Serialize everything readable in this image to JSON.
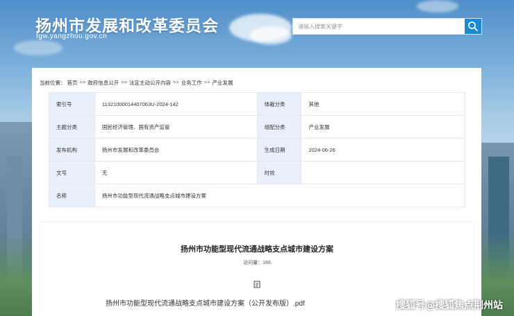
{
  "header": {
    "site_title": "扬州市发展和改革委员会",
    "site_domain": "fgw.yangzhou.gov.cn",
    "search_placeholder": "请输入搜索关键字",
    "search_icon": "search-icon"
  },
  "breadcrumb": {
    "prefix": "当前位置：",
    "separator": ">>",
    "items": [
      "首页",
      "政府信息公开",
      "法定主动公开内容",
      "业务工作",
      "产业发展"
    ]
  },
  "meta": {
    "rows": [
      {
        "k1": "索引号",
        "v1": "11321000014407063U-2024-142",
        "k2": "体裁分类",
        "v2": "其他"
      },
      {
        "k1": "主题分类",
        "v1": "国民经济管理、国有资产监管",
        "k2": "组配分类",
        "v2": "产业发展"
      },
      {
        "k1": "发布机构",
        "v1": "扬州市发展和改革委员会",
        "k2": "生成日期",
        "v2": "2024-06-26"
      },
      {
        "k1": "文号",
        "v1": "无",
        "k2": "时效",
        "v2": ""
      }
    ],
    "name_label": "名称",
    "name_value": "扬州市功能型现代流通战略支点城市建设方案"
  },
  "document": {
    "title": "扬州市功能型现代流通战略支点城市建设方案",
    "visits_label": "访问量：",
    "visits_count": "186",
    "attachment_icon": "file-icon",
    "attachment_name": "扬州市功能型现代流通战略支点城市建设方案（公开发布版）.pdf"
  },
  "watermark": "搜狐号@搜狐焦点荆州站",
  "colors": {
    "accent": "#1b8ad1",
    "label_bg": "#eaf0fb",
    "border": "#e3e8ee"
  }
}
